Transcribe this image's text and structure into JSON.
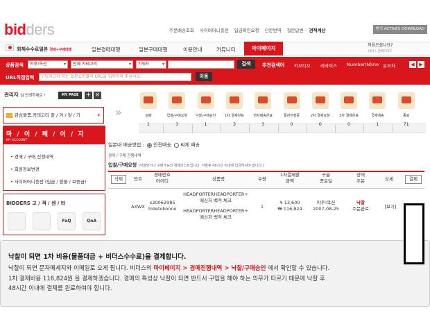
{
  "logo": {
    "part1": "bid",
    "part2": "ders"
  },
  "topnav": [
    "주문배송조회",
    "사이버머니충전",
    "입금확인요청",
    "단문번역",
    "질문답변",
    "견적계산"
  ],
  "activex": "받기 ACTIVEX DOWNLOAD",
  "mainnav": {
    "first": "회제수수료일본",
    "first_sub": "경매+구매대행",
    "items": [
      "일본경매대행",
      "일본구매대행",
      "이용안내",
      "커뮤니티",
      "마이페이지"
    ],
    "guide": "처음오셨나요?",
    "guide_sub": "비더스 완벽가이드"
  },
  "search": {
    "label": "상품검색",
    "site": "야후!옥션",
    "category": "전체 카테고리",
    "keyword_type": "키워드",
    "query": "",
    "button": "검색",
    "reco_label": "추천검색어",
    "reco": [
      "키오디오",
      "리바이스",
      "Number(N)ine",
      "유모차"
    ],
    "url_label": "URL직접입력",
    "url_placeholder": "구입하고자 하는 일본쇼핑몰의 URL을 입력하여 주십시오.",
    "move": "이동"
  },
  "sidebar": {
    "mgr": "관리자",
    "mgr_sub": "님 안녕하세요 !",
    "mypage_btn": "MY PAGE",
    "fav": "관심물품,카테고리 즐 / 겨 / 찾 / 기",
    "my_title": "마 / 이 / 페 / 이 / 지",
    "my_sub": "MY ACCOUNT",
    "links": [
      "경매 / 구매 진행내역",
      "회원정보변경",
      "사이버머니충전 (입금 / 환불 / 보증금)"
    ],
    "cs_title": "BIDDERS 고 / 객 / 센 / 터",
    "cs_icons": [
      "",
      "",
      "FaQ",
      "QnA"
    ]
  },
  "stages": [
    {
      "name": "실패",
      "count": "1"
    },
    {
      "name": "입찰/구매요청",
      "count": "3"
    },
    {
      "name": "낙찰/구매승인",
      "count": "1"
    },
    {
      "name": "1차 결제완료",
      "count": "3"
    },
    {
      "name": "현지배송완료",
      "count": "3"
    },
    {
      "name": "통관진행중",
      "count": "0"
    },
    {
      "name": "2차 결제요청",
      "count": "0"
    },
    {
      "name": "2차 결제완료",
      "count": "0"
    },
    {
      "name": "국제배송",
      "count": "1"
    },
    {
      "name": "종료",
      "count": "71"
    }
  ],
  "shipping": {
    "label": "일본내 배송방법 :",
    "opt1": "안전배송",
    "opt2": "싸게 배송"
  },
  "crumb": "경매 / 구매 진행내역",
  "request": {
    "title": "입찰/구매요청",
    "note": "(낙찰되거나 구매가능한 경매리스트입니다. 낙찰후 48시간 이내에 입금하셔야 합니다.)"
  },
  "table": {
    "delete_btn": "삭제",
    "pay_btn": "결제",
    "headers": [
      "번호",
      "경매번호\n아이디",
      "상품명",
      "수량",
      "1차결제할\n금액",
      "구분\n종료일",
      "상태\n주문",
      "상세"
    ],
    "row": {
      "no": "AXWX",
      "auction": "x20062985",
      "seller": "hidetokonno",
      "name1": "HEADPORTERHEADPORTER+",
      "name2": "메신저 백적 체크",
      "name3": "HEADPORTERHEADPORTER+",
      "name4": "메신저 백적 체크",
      "qty": "1",
      "price1": "¥ 13,600",
      "price2": "₩ 116,824",
      "site": "야후!옥션",
      "date": "2007-08-25",
      "status": "낙찰",
      "order": "주문완료",
      "detail": "[보기]"
    }
  },
  "info": {
    "title": "낙찰이 되면 1차 비용(물품대금 + 비더스수수료)을 결제합니다.",
    "line1_a": "낙찰이 되면 문자메세지와 이메일로 오게 됩니다. 비더스의 ",
    "line1_hl": "마이페이지 > 경매진행내역 > 낙찰/구매승인",
    "line1_b": " 에서 확인할 수 있습니다.",
    "line2": "1차 결제비용 116,824원 을 결제하겠습니다. 경매의 특성상 낙찰이 되면 반드시 구입을 해야 하는 의무가 따르기 때문에 낙찰 후",
    "line3": "48시간 이내에 결제를 완료하여야 합니다."
  }
}
